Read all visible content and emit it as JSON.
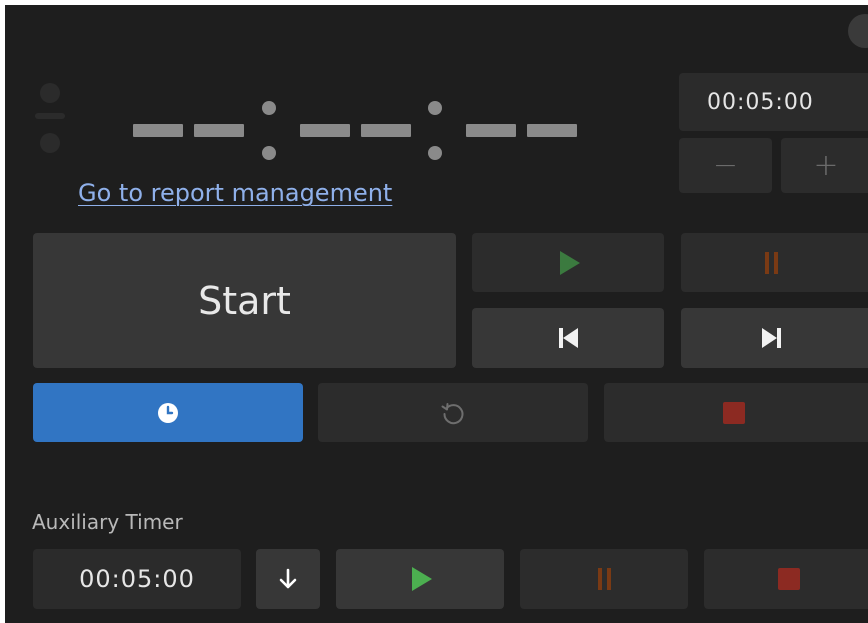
{
  "timer": {
    "display_placeholder": "– – : – – : – –",
    "report_link": "Go to report management"
  },
  "duration": {
    "value": "00:05:00",
    "decrement_label": "−",
    "increment_label": "+"
  },
  "controls": {
    "start_label": "Start"
  },
  "auxiliary": {
    "label": "Auxiliary Timer",
    "value": "00:05:00"
  },
  "colors": {
    "background": "#1e1e1e",
    "button_gray": "#373737",
    "button_dark": "#2c2c2c",
    "accent_blue": "#3175c3",
    "play_green": "#3b7a3f",
    "play_green_bright": "#4caf50",
    "pause_orange": "#7a3a14",
    "stop_red": "#8c2a22",
    "link": "#8fb0ea"
  },
  "icons": {
    "play": "play-icon",
    "pause": "pause-icon",
    "previous": "skip-previous-icon",
    "next": "skip-next-icon",
    "clock": "clock-icon",
    "reset": "reset-icon",
    "stop": "stop-icon",
    "down": "arrow-down-icon"
  }
}
